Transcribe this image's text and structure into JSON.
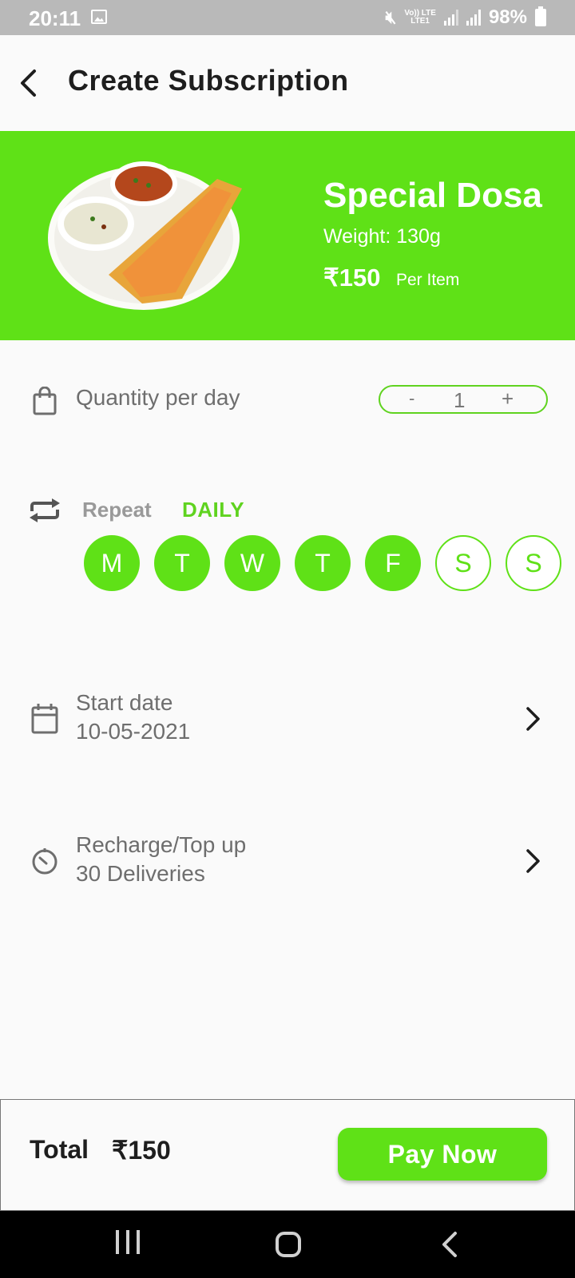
{
  "status_bar": {
    "time": "20:11",
    "network_top": "Vo)) LTE",
    "network_bottom": "LTE1",
    "battery": "98%"
  },
  "header": {
    "title": "Create Subscription"
  },
  "product": {
    "name": "Special Dosa",
    "weight": "Weight: 130g",
    "price": "₹150",
    "unit": "Per Item",
    "banner_color": "#5fe117"
  },
  "quantity": {
    "label": "Quantity per day",
    "minus": "-",
    "value": "1",
    "plus": "+"
  },
  "repeat": {
    "label": "Repeat",
    "value": "DAILY",
    "days": [
      {
        "letter": "M",
        "selected": true
      },
      {
        "letter": "T",
        "selected": true
      },
      {
        "letter": "W",
        "selected": true
      },
      {
        "letter": "T",
        "selected": true
      },
      {
        "letter": "F",
        "selected": true
      },
      {
        "letter": "S",
        "selected": false
      },
      {
        "letter": "S",
        "selected": false
      }
    ]
  },
  "start_date": {
    "label": "Start date",
    "value": "10-05-2021"
  },
  "recharge": {
    "label": "Recharge/Top up",
    "value": "30 Deliveries"
  },
  "footer": {
    "total_label": "Total",
    "total_value": "₹150",
    "pay_label": "Pay Now"
  },
  "icons": {
    "back": "back-arrow-icon",
    "quantity": "shopping-bag-icon",
    "repeat": "repeat-icon",
    "start_date": "calendar-icon",
    "recharge": "timer-icon",
    "row_chevron": "chevron-right-icon"
  },
  "colors": {
    "accent": "#5fe117",
    "accent_text": "#5fd31f"
  }
}
